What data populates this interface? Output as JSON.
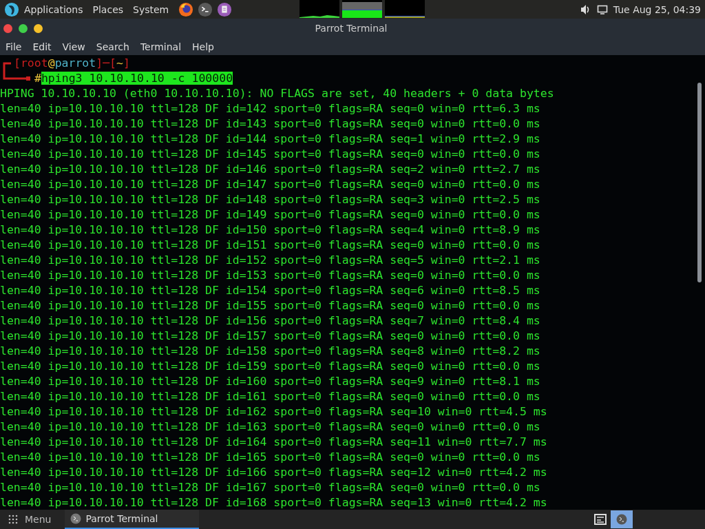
{
  "top_panel": {
    "menus": [
      "Applications",
      "Places",
      "System"
    ],
    "clock": "Tue Aug 25, 04:39"
  },
  "window": {
    "title": "Parrot Terminal"
  },
  "menu_bar": [
    "File",
    "Edit",
    "View",
    "Search",
    "Terminal",
    "Help"
  ],
  "terminal": {
    "prompt": [
      {
        "text": "[",
        "color": "#cc1f1f"
      },
      {
        "text": "root",
        "color": "#cc1f1f"
      },
      {
        "text": "@",
        "color": "#e8c33a"
      },
      {
        "text": "parrot",
        "color": "#4fb3c9"
      },
      {
        "text": "]",
        "color": "#cc1f1f"
      },
      {
        "text": "─",
        "color": "#cc1f1f"
      },
      {
        "text": "[",
        "color": "#cc1f1f"
      },
      {
        "text": "~",
        "color": "#e8c33a"
      },
      {
        "text": "]",
        "color": "#cc1f1f"
      }
    ],
    "prompt_symbol": "#",
    "command": "hping3 10.10.10.10 -c 100000",
    "output": [
      "HPING 10.10.10.10 (eth0 10.10.10.10): NO FLAGS are set, 40 headers + 0 data bytes",
      "len=40 ip=10.10.10.10 ttl=128 DF id=142 sport=0 flags=RA seq=0 win=0 rtt=6.3 ms",
      "len=40 ip=10.10.10.10 ttl=128 DF id=143 sport=0 flags=RA seq=0 win=0 rtt=0.0 ms",
      "len=40 ip=10.10.10.10 ttl=128 DF id=144 sport=0 flags=RA seq=1 win=0 rtt=2.9 ms",
      "len=40 ip=10.10.10.10 ttl=128 DF id=145 sport=0 flags=RA seq=0 win=0 rtt=0.0 ms",
      "len=40 ip=10.10.10.10 ttl=128 DF id=146 sport=0 flags=RA seq=2 win=0 rtt=2.7 ms",
      "len=40 ip=10.10.10.10 ttl=128 DF id=147 sport=0 flags=RA seq=0 win=0 rtt=0.0 ms",
      "len=40 ip=10.10.10.10 ttl=128 DF id=148 sport=0 flags=RA seq=3 win=0 rtt=2.5 ms",
      "len=40 ip=10.10.10.10 ttl=128 DF id=149 sport=0 flags=RA seq=0 win=0 rtt=0.0 ms",
      "len=40 ip=10.10.10.10 ttl=128 DF id=150 sport=0 flags=RA seq=4 win=0 rtt=8.9 ms",
      "len=40 ip=10.10.10.10 ttl=128 DF id=151 sport=0 flags=RA seq=0 win=0 rtt=0.0 ms",
      "len=40 ip=10.10.10.10 ttl=128 DF id=152 sport=0 flags=RA seq=5 win=0 rtt=2.1 ms",
      "len=40 ip=10.10.10.10 ttl=128 DF id=153 sport=0 flags=RA seq=0 win=0 rtt=0.0 ms",
      "len=40 ip=10.10.10.10 ttl=128 DF id=154 sport=0 flags=RA seq=6 win=0 rtt=8.5 ms",
      "len=40 ip=10.10.10.10 ttl=128 DF id=155 sport=0 flags=RA seq=0 win=0 rtt=0.0 ms",
      "len=40 ip=10.10.10.10 ttl=128 DF id=156 sport=0 flags=RA seq=7 win=0 rtt=8.4 ms",
      "len=40 ip=10.10.10.10 ttl=128 DF id=157 sport=0 flags=RA seq=0 win=0 rtt=0.0 ms",
      "len=40 ip=10.10.10.10 ttl=128 DF id=158 sport=0 flags=RA seq=8 win=0 rtt=8.2 ms",
      "len=40 ip=10.10.10.10 ttl=128 DF id=159 sport=0 flags=RA seq=0 win=0 rtt=0.0 ms",
      "len=40 ip=10.10.10.10 ttl=128 DF id=160 sport=0 flags=RA seq=9 win=0 rtt=8.1 ms",
      "len=40 ip=10.10.10.10 ttl=128 DF id=161 sport=0 flags=RA seq=0 win=0 rtt=0.0 ms",
      "len=40 ip=10.10.10.10 ttl=128 DF id=162 sport=0 flags=RA seq=10 win=0 rtt=4.5 ms",
      "len=40 ip=10.10.10.10 ttl=128 DF id=163 sport=0 flags=RA seq=0 win=0 rtt=0.0 ms",
      "len=40 ip=10.10.10.10 ttl=128 DF id=164 sport=0 flags=RA seq=11 win=0 rtt=7.7 ms",
      "len=40 ip=10.10.10.10 ttl=128 DF id=165 sport=0 flags=RA seq=0 win=0 rtt=0.0 ms",
      "len=40 ip=10.10.10.10 ttl=128 DF id=166 sport=0 flags=RA seq=12 win=0 rtt=4.2 ms",
      "len=40 ip=10.10.10.10 ttl=128 DF id=167 sport=0 flags=RA seq=0 win=0 rtt=0.0 ms",
      "len=40 ip=10.10.10.10 ttl=128 DF id=168 sport=0 flags=RA seq=13 win=0 rtt=4.2 ms"
    ]
  },
  "taskbar": {
    "menu_label": "Menu",
    "tasks": [
      {
        "label": "Parrot Terminal",
        "selected": true
      }
    ]
  }
}
